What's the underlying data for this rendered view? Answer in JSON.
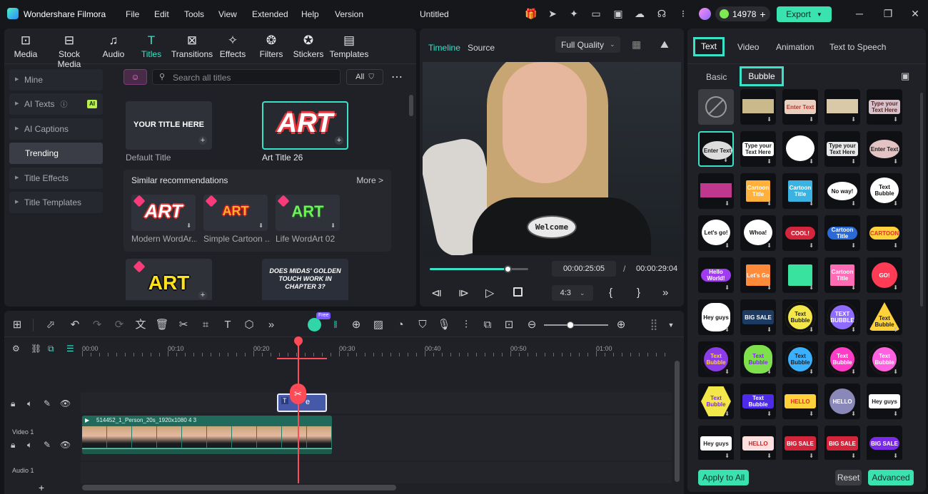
{
  "app": {
    "name": "Wondershare Filmora",
    "doc_title": "Untitled",
    "credits": "14978",
    "export_label": "Export"
  },
  "menu": [
    "File",
    "Edit",
    "Tools",
    "View",
    "Extended",
    "Help",
    "Version"
  ],
  "topnav": [
    {
      "label": "Media",
      "icon": "media-icon"
    },
    {
      "label": "Stock Media",
      "icon": "stock-media-icon"
    },
    {
      "label": "Audio",
      "icon": "audio-icon"
    },
    {
      "label": "Titles",
      "icon": "titles-icon"
    },
    {
      "label": "Transitions",
      "icon": "transitions-icon"
    },
    {
      "label": "Effects",
      "icon": "effects-icon"
    },
    {
      "label": "Filters",
      "icon": "filters-icon"
    },
    {
      "label": "Stickers",
      "icon": "stickers-icon"
    },
    {
      "label": "Templates",
      "icon": "templates-icon"
    }
  ],
  "sidebar": [
    "Mine",
    "AI Texts",
    "AI Captions",
    "Trending",
    "Title Effects",
    "Title Templates"
  ],
  "sidebar_badge": "AI",
  "search": {
    "placeholder": "Search all titles",
    "filter_label": "All"
  },
  "titles": {
    "default_caption": "Default Title",
    "default_text": "YOUR TITLE HERE",
    "art26_caption": "Art Title 26",
    "art_text": "ART",
    "similar_heading": "Similar recommendations",
    "more_label": "More >",
    "rec": [
      "Modern WordAr...",
      "Simple Cartoon ...",
      "Life WordArt 02"
    ],
    "bottom_card2": "DOES MIDAS' GOLDEN TOUCH WORK IN CHAPTER 3?"
  },
  "player": {
    "tab_timeline": "Timeline",
    "tab_source": "Source",
    "quality": "Full Quality",
    "sticker_text": "Welcome",
    "current": "00:00:25:05",
    "sep": "/",
    "total": "00:00:29:04",
    "ratio": "4:3",
    "progress": 0.78
  },
  "right": {
    "tabs": [
      "Text",
      "Video",
      "Animation",
      "Text to Speech"
    ],
    "subtabs": [
      "Basic",
      "Bubble"
    ],
    "apply_all": "Apply to All",
    "reset": "Reset",
    "advanced": "Advanced",
    "bubbles": [
      "",
      "",
      "Enter Text",
      "",
      "Type your Text Here",
      "Enter Text",
      "Type your Text Here",
      "",
      "Type your Text Here",
      "Enter Text",
      "",
      "Cartoon Title",
      "Cartoon Title",
      "No way!",
      "Text Bubble",
      "Let's go!",
      "Whoa!",
      "COOL!",
      "Cartoon Title",
      "CARTOON",
      "Hello World!",
      "Let's Go",
      "",
      "Cartoon Title",
      "GO!",
      "Hey guys",
      "BIG SALE",
      "Text Bubble",
      "TEXT BUBBLE",
      "Text Bubble",
      "Text Bubble",
      "Text Bubble",
      "Text Bubble",
      "Text Bubble",
      "Text Bubble",
      "Text Bubble",
      "Text Bubble",
      "HELLO",
      "HELLO",
      "Hey guys",
      "Hey guys",
      "HELLO",
      "BIG SALE",
      "BIG SALE",
      "BIG SALE"
    ]
  },
  "timeline": {
    "ticks": [
      "00:00",
      "00:10",
      "00:20",
      "00:30",
      "00:40",
      "00:50",
      "01:00"
    ],
    "track_video_label": "Video 1",
    "track_audio_label": "Audio 1",
    "clip_name": "514452_1_Person_20s_1920x1080 4 3",
    "title_clip": "e",
    "free_badge": "Free"
  }
}
